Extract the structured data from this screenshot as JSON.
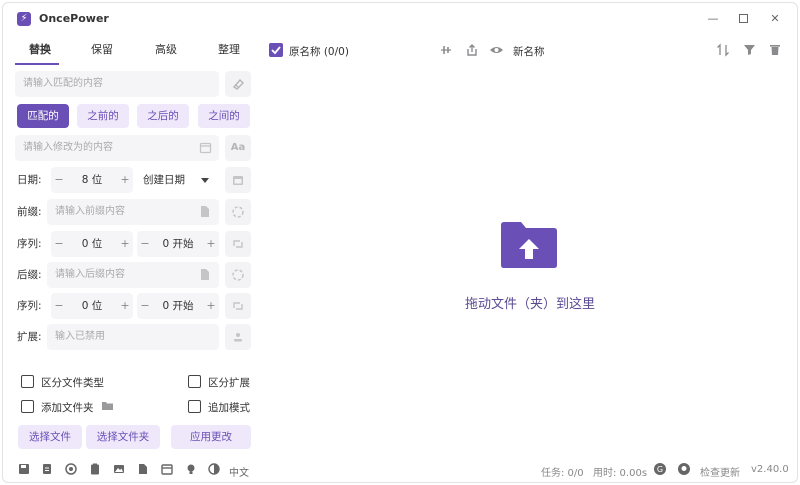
{
  "app": {
    "title": "OncePower",
    "accent": "#6a4fb6"
  },
  "tabs": [
    {
      "label": "替换",
      "active": true
    },
    {
      "label": "保留"
    },
    {
      "label": "高级"
    },
    {
      "label": "整理"
    }
  ],
  "replace": {
    "match_placeholder": "请输入匹配的内容",
    "modes": [
      "匹配的",
      "之前的",
      "之后的",
      "之间的"
    ],
    "replace_placeholder": "请输入修改为的内容",
    "case_label": "Aa"
  },
  "date": {
    "label": "日期:",
    "value": "8 位",
    "select": "创建日期"
  },
  "prefix": {
    "label": "前缀:",
    "placeholder": "请输入前缀内容"
  },
  "sequence1": {
    "label": "序列:",
    "digits": "0 位",
    "start": "0 开始"
  },
  "suffix": {
    "label": "后缀:",
    "placeholder": "请输入后缀内容"
  },
  "sequence2": {
    "label": "序列:",
    "digits": "0 位",
    "start": "0 开始"
  },
  "extension": {
    "label": "扩展:",
    "placeholder": "输入已禁用"
  },
  "options": {
    "distinguish_file_type": "区分文件类型",
    "distinguish_extension": "区分扩展",
    "add_folder": "添加文件夹",
    "append_mode": "追加模式"
  },
  "actions": {
    "select_files": "选择文件",
    "select_folder": "选择文件夹",
    "apply": "应用更改"
  },
  "list_header": {
    "original": "原名称 (0/0)",
    "new_name": "新名称"
  },
  "dropzone": {
    "text": "拖动文件（夹）到这里"
  },
  "status": {
    "language": "中文",
    "tasks": "任务: 0/0",
    "time": "用时: 0.00s",
    "check_update": "检查更新",
    "version": "v2.40.0"
  }
}
